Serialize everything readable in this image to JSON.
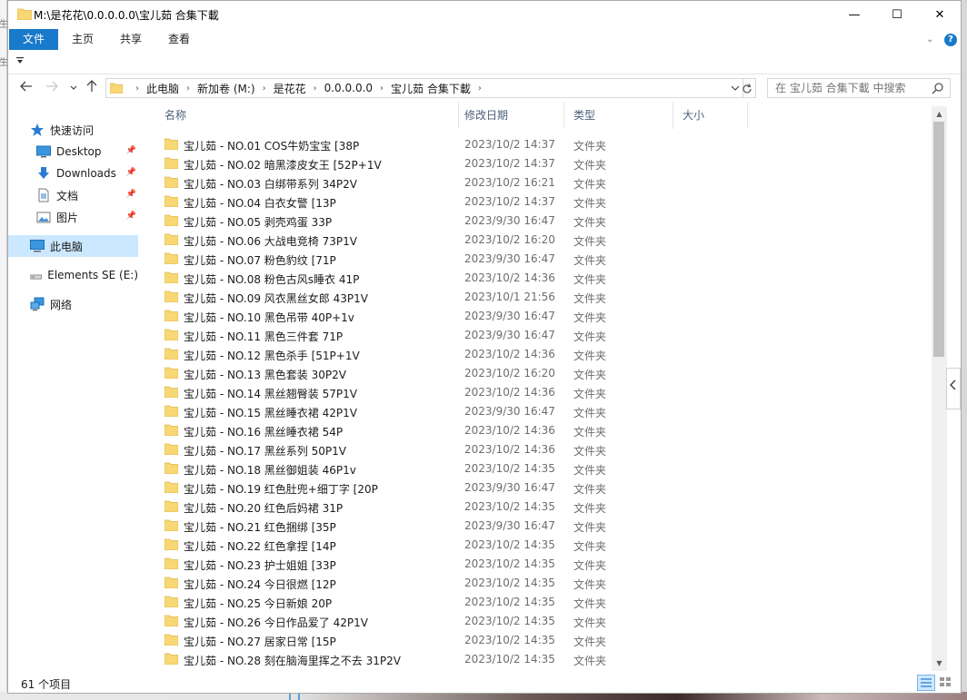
{
  "window": {
    "title": "M:\\是花花\\0.0.0.0.0\\宝儿茹 合集下載",
    "minimize_glyph": "—",
    "maximize_glyph": "☐",
    "close_glyph": "✕"
  },
  "ribbon": {
    "tabs": [
      "文件",
      "主页",
      "共享",
      "查看"
    ],
    "active_tab": "文件",
    "accent": "#1979ca",
    "help_glyph": "?",
    "expand_glyph": "⌄"
  },
  "address": {
    "breadcrumbs": [
      "此电脑",
      "新加卷 (M:)",
      "是花花",
      "0.0.0.0.0",
      "宝儿茹 合集下載"
    ],
    "search_placeholder": "在 宝儿茹 合集下載 中搜索"
  },
  "nav_pane": {
    "items": [
      {
        "label": "快速访问",
        "icon": "star-icon",
        "pinned": false,
        "selected": false
      },
      {
        "label": "Desktop",
        "icon": "desktop-icon",
        "pinned": true,
        "selected": false
      },
      {
        "label": "Downloads",
        "icon": "download-arrow-icon",
        "pinned": true,
        "selected": false
      },
      {
        "label": "文档",
        "icon": "document-icon",
        "pinned": true,
        "selected": false
      },
      {
        "label": "图片",
        "icon": "picture-icon",
        "pinned": true,
        "selected": false
      },
      {
        "label": "此电脑",
        "icon": "computer-icon",
        "pinned": false,
        "selected": true
      },
      {
        "label": "Elements SE (E:)",
        "icon": "drive-icon",
        "pinned": false,
        "selected": false
      },
      {
        "label": "网络",
        "icon": "network-icon",
        "pinned": false,
        "selected": false
      }
    ],
    "pin_glyph": "📌"
  },
  "columns": {
    "name": "名称",
    "date": "修改日期",
    "type": "类型",
    "size": "大小"
  },
  "files": [
    {
      "name": "宝儿茹 - NO.01 COS牛奶宝宝 [38P",
      "date": "2023/10/2 14:37",
      "type": "文件夹"
    },
    {
      "name": "宝儿茹 - NO.02 暗黑漆皮女王 [52P+1V",
      "date": "2023/10/2 14:37",
      "type": "文件夹"
    },
    {
      "name": "宝儿茹 - NO.03 白绑带系列 34P2V",
      "date": "2023/10/2 16:21",
      "type": "文件夹"
    },
    {
      "name": "宝儿茹 - NO.04 白衣女警 [13P",
      "date": "2023/10/2 14:37",
      "type": "文件夹"
    },
    {
      "name": "宝儿茹 - NO.05 剥壳鸡蛋 33P",
      "date": "2023/9/30 16:47",
      "type": "文件夹"
    },
    {
      "name": "宝儿茹 - NO.06 大战电竞椅 73P1V",
      "date": "2023/10/2 16:20",
      "type": "文件夹"
    },
    {
      "name": "宝儿茹 - NO.07 粉色豹纹 [71P",
      "date": "2023/9/30 16:47",
      "type": "文件夹"
    },
    {
      "name": "宝儿茹 - NO.08 粉色古风s睡衣 41P",
      "date": "2023/10/2 14:36",
      "type": "文件夹"
    },
    {
      "name": "宝儿茹 - NO.09 风衣黑丝女郎 43P1V",
      "date": "2023/10/1 21:56",
      "type": "文件夹"
    },
    {
      "name": "宝儿茹 - NO.10 黑色吊带 40P+1v",
      "date": "2023/9/30 16:47",
      "type": "文件夹"
    },
    {
      "name": "宝儿茹 - NO.11 黑色三件套 71P",
      "date": "2023/9/30 16:47",
      "type": "文件夹"
    },
    {
      "name": "宝儿茹 - NO.12 黑色杀手 [51P+1V",
      "date": "2023/10/2 14:36",
      "type": "文件夹"
    },
    {
      "name": "宝儿茹 - NO.13 黑色套装 30P2V",
      "date": "2023/10/2 16:20",
      "type": "文件夹"
    },
    {
      "name": "宝儿茹 - NO.14 黑丝翘臀装 57P1V",
      "date": "2023/10/2 14:36",
      "type": "文件夹"
    },
    {
      "name": "宝儿茹 - NO.15 黑丝睡衣裙 42P1V",
      "date": "2023/9/30 16:47",
      "type": "文件夹"
    },
    {
      "name": "宝儿茹 - NO.16 黑丝睡衣裙 54P",
      "date": "2023/10/2 14:36",
      "type": "文件夹"
    },
    {
      "name": "宝儿茹 - NO.17 黑丝系列 50P1V",
      "date": "2023/10/2 14:36",
      "type": "文件夹"
    },
    {
      "name": "宝儿茹 - NO.18 黑丝御姐装 46P1v",
      "date": "2023/10/2 14:35",
      "type": "文件夹"
    },
    {
      "name": "宝儿茹 - NO.19 红色肚兜+细丁字 [20P",
      "date": "2023/9/30 16:47",
      "type": "文件夹"
    },
    {
      "name": "宝儿茹 - NO.20 红色后妈裙 31P",
      "date": "2023/10/2 14:35",
      "type": "文件夹"
    },
    {
      "name": "宝儿茹 - NO.21 红色捆绑 [35P",
      "date": "2023/9/30 16:47",
      "type": "文件夹"
    },
    {
      "name": "宝儿茹 - NO.22 红色拿捏 [14P",
      "date": "2023/10/2 14:35",
      "type": "文件夹"
    },
    {
      "name": "宝儿茹 - NO.23 护士姐姐 [33P",
      "date": "2023/10/2 14:35",
      "type": "文件夹"
    },
    {
      "name": "宝儿茹 - NO.24 今日很燃 [12P",
      "date": "2023/10/2 14:35",
      "type": "文件夹"
    },
    {
      "name": "宝儿茹 - NO.25 今日新娘 20P",
      "date": "2023/10/2 14:35",
      "type": "文件夹"
    },
    {
      "name": "宝儿茹 - NO.26 今日作品爱了 42P1V",
      "date": "2023/10/2 14:35",
      "type": "文件夹"
    },
    {
      "name": "宝儿茹 - NO.27 居家日常 [15P",
      "date": "2023/10/2 14:35",
      "type": "文件夹"
    },
    {
      "name": "宝儿茹 - NO.28 刻在脑海里挥之不去 31P2V",
      "date": "2023/10/2 14:35",
      "type": "文件夹"
    }
  ],
  "status": {
    "item_count": "61 个项目"
  },
  "scrollbar": {
    "thumb_fraction": 0.44
  }
}
